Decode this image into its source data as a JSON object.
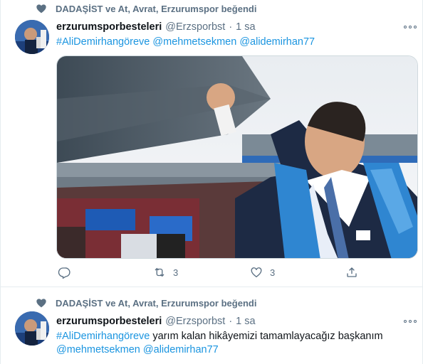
{
  "tweets": [
    {
      "social_context": "DADAŞİST ve At, Avrat, Erzurumspor beğendi",
      "name": "erzurumsporbesteleri",
      "handle": "@Erzsporbst",
      "separator": "·",
      "time": "1 sa",
      "text_parts": [
        "#AliDemirhangöreve",
        " ",
        "@mehmetsekmen",
        " ",
        "@alidemirhan77"
      ],
      "media_alt": "photo-man-in-stadium-with-blue-scarf",
      "actions": {
        "reply_count": "",
        "retweet_count": "3",
        "like_count": "3"
      }
    },
    {
      "social_context": "DADAŞİST ve At, Avrat, Erzurumspor beğendi",
      "name": "erzurumsporbesteleri",
      "handle": "@Erzsporbst",
      "separator": "·",
      "time": "1 sa",
      "text_line1": [
        "#AliDemirhangöreve",
        " yarım kalan hikâyemizi tamamlayacağız başkanım"
      ],
      "text_line2": [
        "@mehmetsekmen",
        " ",
        "@alidemirhan77"
      ]
    }
  ],
  "colors": {
    "link": "#1b95e0",
    "secondary": "#5b7083",
    "primary": "#0f1419",
    "border": "#e6ecf0"
  },
  "icons": {
    "like_context": "heart-icon",
    "more": "more-icon",
    "reply": "reply-icon",
    "retweet": "retweet-icon",
    "like": "like-icon",
    "share": "share-icon"
  }
}
